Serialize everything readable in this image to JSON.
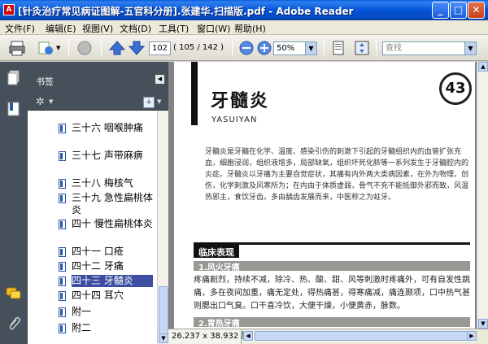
{
  "window": {
    "title": "[针灸治疗常见病证图解-五官科分册].张建华.扫描版.pdf - Adobe Reader",
    "minimize": "_",
    "maximize": "□",
    "close": "✕"
  },
  "menu": {
    "file": "文件(F)",
    "edit": "编辑(E)",
    "view": "视图(V)",
    "document": "文档(D)",
    "tools": "工具(T)",
    "window": "窗口(W)",
    "help": "帮助(H)"
  },
  "toolbar": {
    "page_current": "102",
    "page_count": "( 105 / 142 )",
    "zoom": "50%",
    "search_placeholder": "查找"
  },
  "bookmarks": {
    "title": "书签",
    "items": [
      {
        "label": "三十六  咽喉肿痛"
      },
      {
        "label": "三十七  声带麻痹"
      },
      {
        "label": "三十八  梅核气"
      },
      {
        "label": "三十九  急性扁桃体炎"
      },
      {
        "label": "四十  慢性扁桃体炎"
      },
      {
        "label": "四十一  口疮"
      },
      {
        "label": "四十二  牙痛"
      },
      {
        "label": "四十三  牙髓炎"
      },
      {
        "label": "四十四  耳穴"
      },
      {
        "label": "附一"
      },
      {
        "label": "附二"
      }
    ],
    "selected_index": 7
  },
  "document": {
    "chapter_title": "牙髓炎",
    "chapter_subtitle": "YASUIYAN",
    "chapter_number": "43",
    "intro": "牙髓炎是牙髓在化学、温度、感染引伤的刺激下引起的牙髓组织内的血管扩张充血，细胞浸润，组织液增多，局部缺氧，组织坏死化脓等一系列发生于牙髓腔内的炎症。牙髓炎以牙痛为主要自觉症状，其痛有内外两大类病因素，在外为物理，创伤，化学刺激及风寒所为；在内由于体质虚弱，骨气不充不能抵御外邪而致，风温热邪主，食饮牙齿。多由龋齿发展而来，中医称之为蛀牙。",
    "section_title": "临床表现",
    "subsection1": "1.风火牙痛",
    "body": "疼痛剧烈，持续不减，除冷、热、酸、甜、风等刺激时疼痛外，可有自发性跳痛，多在夜间加重，痛无定处，得热痛甚，得寒痛减，痛连颞项，口中热气甚则腮出口气臭。口干喜冷饮，大便干燥，小便黄赤，脉数。",
    "subsection2": "2.胃热牙痛"
  },
  "status": {
    "page_size": "26.237 x 38.932 厘米"
  }
}
